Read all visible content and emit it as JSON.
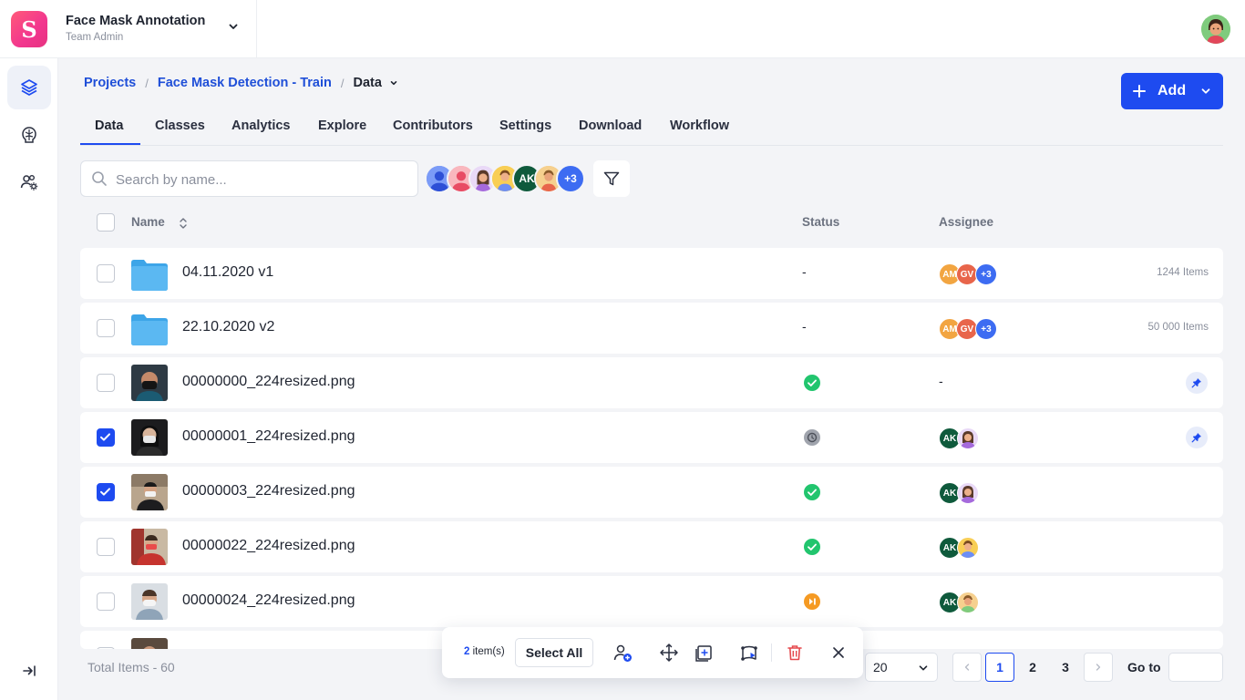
{
  "workspace": {
    "name": "Face Mask Annotation",
    "role": "Team Admin"
  },
  "breadcrumb": {
    "projects": "Projects",
    "project": "Face Mask Detection - Train",
    "current": "Data"
  },
  "add_button": {
    "label": "Add"
  },
  "tabs": [
    {
      "label": "Data",
      "active": true
    },
    {
      "label": "Classes"
    },
    {
      "label": "Analytics"
    },
    {
      "label": "Explore"
    },
    {
      "label": "Contributors"
    },
    {
      "label": "Settings"
    },
    {
      "label": "Download"
    },
    {
      "label": "Workflow"
    }
  ],
  "search": {
    "placeholder": "Search by name..."
  },
  "contributors": {
    "initials": "AK",
    "more": "+3"
  },
  "table": {
    "headers": {
      "name": "Name",
      "status": "Status",
      "assignee": "Assignee"
    },
    "rows": [
      {
        "name": "04.11.2020 v1",
        "type": "folder",
        "status": "-",
        "assignees": [
          "AM",
          "GV",
          "+3"
        ],
        "items": "1244 Items",
        "checked": false
      },
      {
        "name": "22.10.2020 v2",
        "type": "folder",
        "status": "-",
        "assignees": [
          "AM",
          "GV",
          "+3"
        ],
        "items": "50 000 Items",
        "checked": false
      },
      {
        "name": "00000000_224resized.png",
        "type": "image",
        "status": "completed",
        "assignee_text": "-",
        "pinned": true,
        "checked": false
      },
      {
        "name": "00000001_224resized.png",
        "type": "image",
        "status": "not-started",
        "assignees": [
          "AK"
        ],
        "pinned": true,
        "checked": true
      },
      {
        "name": "00000003_224resized.png",
        "type": "image",
        "status": "completed",
        "assignees": [
          "AK"
        ],
        "checked": true
      },
      {
        "name": "00000022_224resized.png",
        "type": "image",
        "status": "completed",
        "assignees": [
          "AK"
        ],
        "checked": false
      },
      {
        "name": "00000024_224resized.png",
        "type": "image",
        "status": "in-progress",
        "assignees": [
          "AK"
        ],
        "checked": false
      }
    ]
  },
  "colors": {
    "accent": "#1E4BF0",
    "completed": "#22C56E",
    "in_progress": "#F59A23",
    "not_started": "#A0A4AD"
  },
  "footer": {
    "total": "Total Items - 60",
    "per_page": "20",
    "pages": [
      "1",
      "2",
      "3"
    ],
    "current_page": "1",
    "goto_label": "Go to"
  },
  "action_bar": {
    "count": "2",
    "count_suffix": "item(s)",
    "select_all": "Select All"
  }
}
